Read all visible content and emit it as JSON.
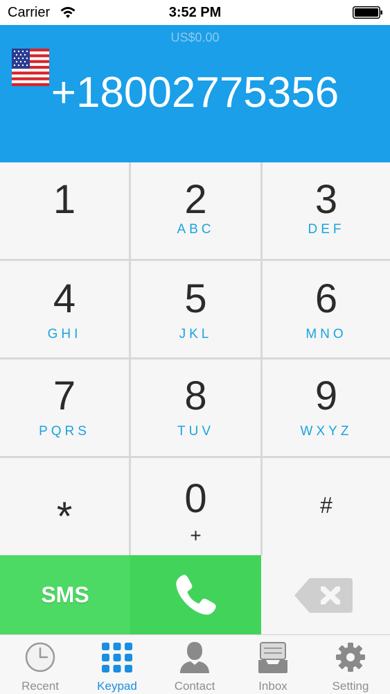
{
  "status_bar": {
    "carrier": "Carrier",
    "time": "3:52 PM"
  },
  "header": {
    "balance": "US$0.00",
    "country_flag": "us-flag-icon",
    "phone_number": "+18002775356"
  },
  "keypad": {
    "keys": [
      {
        "digit": "1",
        "letters": ""
      },
      {
        "digit": "2",
        "letters": "ABC"
      },
      {
        "digit": "3",
        "letters": "DEF"
      },
      {
        "digit": "4",
        "letters": "GHI"
      },
      {
        "digit": "5",
        "letters": "JKL"
      },
      {
        "digit": "6",
        "letters": "MNO"
      },
      {
        "digit": "7",
        "letters": "PQRS"
      },
      {
        "digit": "8",
        "letters": "TUV"
      },
      {
        "digit": "9",
        "letters": "WXYZ"
      },
      {
        "digit": "*",
        "letters": ""
      },
      {
        "digit": "0",
        "letters": "+"
      },
      {
        "digit": "#",
        "letters": ""
      }
    ]
  },
  "actions": {
    "sms_label": "SMS",
    "call_icon": "phone-icon",
    "delete_icon": "backspace-icon"
  },
  "tab_bar": {
    "tabs": [
      {
        "label": "Recent",
        "icon": "clock-icon",
        "active": false
      },
      {
        "label": "Keypad",
        "icon": "keypad-grid-icon",
        "active": true
      },
      {
        "label": "Contact",
        "icon": "person-icon",
        "active": false
      },
      {
        "label": "Inbox",
        "icon": "inbox-tray-icon",
        "active": false
      },
      {
        "label": "Setting",
        "icon": "gear-icon",
        "active": false
      }
    ]
  },
  "colors": {
    "header_bg": "#1a9fe8",
    "accent_blue": "#1aa4df",
    "sms_green": "#4cd964",
    "call_green": "#42d35a",
    "tab_active": "#1a8ee0"
  }
}
